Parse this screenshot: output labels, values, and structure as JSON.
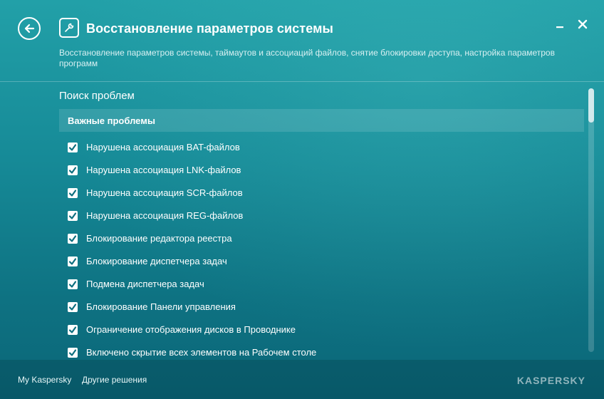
{
  "header": {
    "title": "Восстановление параметров системы",
    "subtitle": "Восстановление параметров системы, таймаутов и ассоциаций файлов, снятие блокировки доступа, настройка параметров программ",
    "back_icon": "back-arrow-icon",
    "title_icon": "wrench-icon",
    "minimize_icon": "minimize-icon",
    "close_icon": "close-icon"
  },
  "main": {
    "section_title": "Поиск проблем",
    "group_title": "Важные проблемы",
    "items": [
      {
        "label": "Нарушена ассоциация BAT-файлов",
        "checked": true
      },
      {
        "label": "Нарушена ассоциация LNK-файлов",
        "checked": true
      },
      {
        "label": "Нарушена ассоциация SCR-файлов",
        "checked": true
      },
      {
        "label": "Нарушена ассоциация REG-файлов",
        "checked": true
      },
      {
        "label": "Блокирование редактора реестра",
        "checked": true
      },
      {
        "label": "Блокирование диспетчера задач",
        "checked": true
      },
      {
        "label": "Подмена диспетчера задач",
        "checked": true
      },
      {
        "label": "Блокирование Панели управления",
        "checked": true
      },
      {
        "label": "Ограничение отображения дисков в Проводнике",
        "checked": true
      },
      {
        "label": "Включено скрытие всех элементов на Рабочем столе",
        "checked": true
      }
    ]
  },
  "footer": {
    "link1": "My Kaspersky",
    "link2": "Другие решения",
    "logo": "KASPERSKY"
  },
  "colors": {
    "accent": "#1a8c98",
    "check": "#0e6f7f"
  }
}
